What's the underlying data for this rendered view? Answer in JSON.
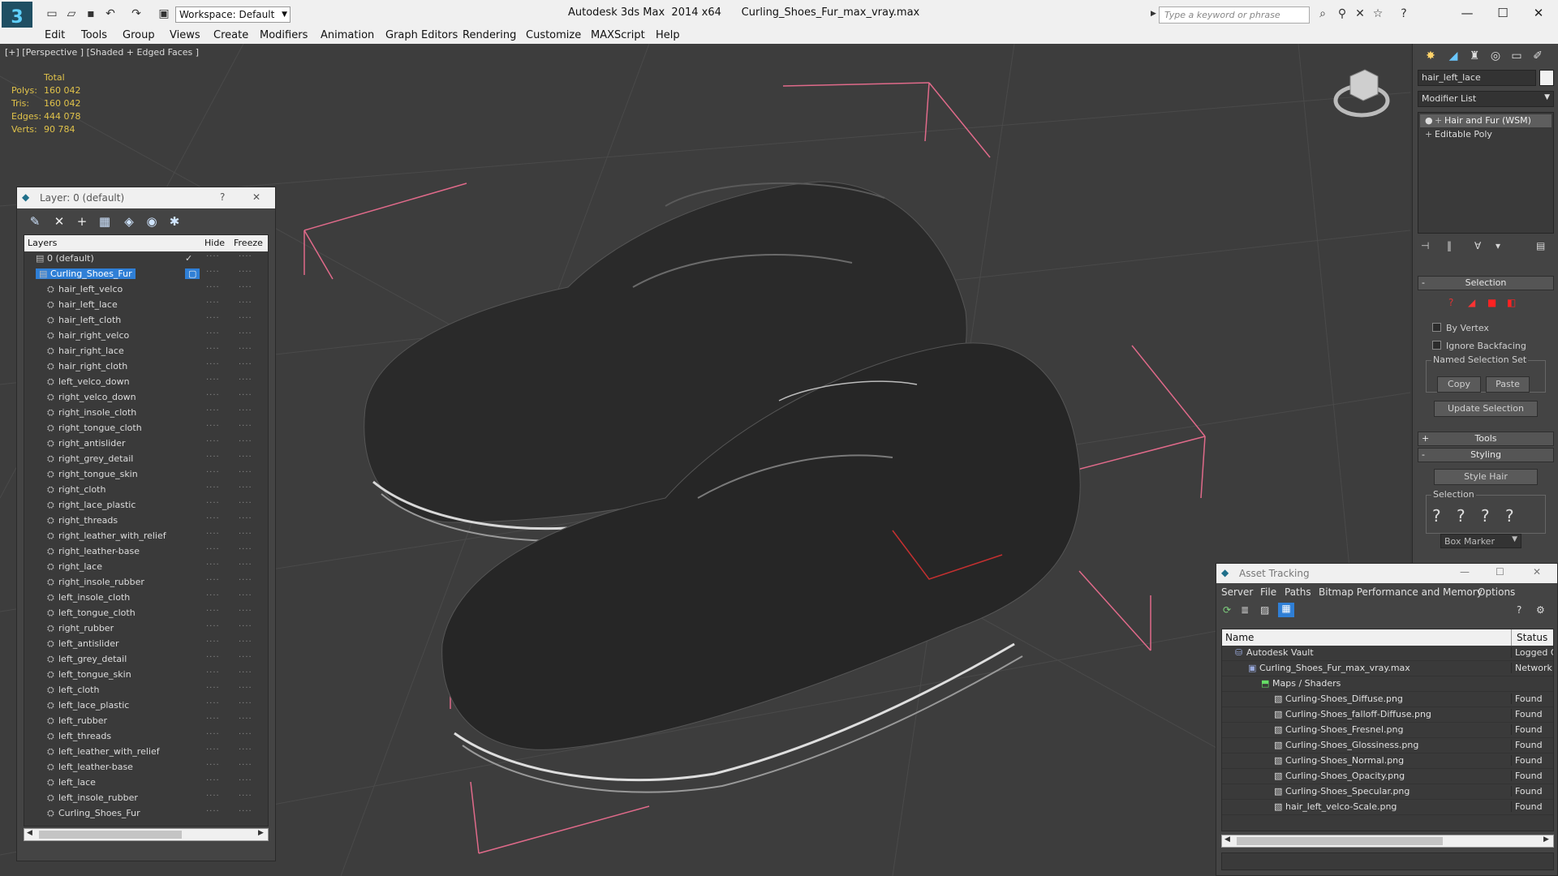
{
  "window": {
    "title": "Autodesk 3ds Max  2014 x64      Curling_Shoes_Fur_max_vray.max",
    "workspace": "Workspace: Default",
    "search_placeholder": "Type a keyword or phrase"
  },
  "menu": [
    "Edit",
    "Tools",
    "Group",
    "Views",
    "Create",
    "Modifiers",
    "Animation",
    "Graph Editors",
    "Rendering",
    "Customize",
    "MAXScript",
    "Help"
  ],
  "viewport": {
    "label": "[+] [Perspective ] [Shaded + Edged Faces ]",
    "stats": {
      "total_label": "Total",
      "rows": [
        {
          "label": "Polys:",
          "value": "160 042"
        },
        {
          "label": "Tris:",
          "value": "160 042"
        },
        {
          "label": "Edges:",
          "value": "444 078"
        },
        {
          "label": "Verts:",
          "value": "90 784"
        }
      ]
    }
  },
  "layer_explorer": {
    "title": "Layer: 0 (default)",
    "help": "?",
    "close": "✕",
    "headers": {
      "layers": "Layers",
      "hide": "Hide",
      "freeze": "Freeze"
    },
    "rows": [
      {
        "name": "0 (default)",
        "level": 1
      },
      {
        "name": "Curling_Shoes_Fur",
        "level": 1
      },
      {
        "name": "hair_left_velco",
        "level": 2
      },
      {
        "name": "hair_left_lace",
        "level": 2
      },
      {
        "name": "hair_left_cloth",
        "level": 2
      },
      {
        "name": "hair_right_velco",
        "level": 2
      },
      {
        "name": "hair_right_lace",
        "level": 2
      },
      {
        "name": "hair_right_cloth",
        "level": 2
      },
      {
        "name": "left_velco_down",
        "level": 2
      },
      {
        "name": "right_velco_down",
        "level": 2
      },
      {
        "name": "right_insole_cloth",
        "level": 2
      },
      {
        "name": "right_tongue_cloth",
        "level": 2
      },
      {
        "name": "right_antislider",
        "level": 2
      },
      {
        "name": "right_grey_detail",
        "level": 2
      },
      {
        "name": "right_tongue_skin",
        "level": 2
      },
      {
        "name": "right_cloth",
        "level": 2
      },
      {
        "name": "right_lace_plastic",
        "level": 2
      },
      {
        "name": "right_threads",
        "level": 2
      },
      {
        "name": "right_leather_with_relief",
        "level": 2
      },
      {
        "name": "right_leather-base",
        "level": 2
      },
      {
        "name": "right_lace",
        "level": 2
      },
      {
        "name": "right_insole_rubber",
        "level": 2
      },
      {
        "name": "left_insole_cloth",
        "level": 2
      },
      {
        "name": "left_tongue_cloth",
        "level": 2
      },
      {
        "name": "right_rubber",
        "level": 2
      },
      {
        "name": "left_antislider",
        "level": 2
      },
      {
        "name": "left_grey_detail",
        "level": 2
      },
      {
        "name": "left_tongue_skin",
        "level": 2
      },
      {
        "name": "left_cloth",
        "level": 2
      },
      {
        "name": "left_lace_plastic",
        "level": 2
      },
      {
        "name": "left_rubber",
        "level": 2
      },
      {
        "name": "left_threads",
        "level": 2
      },
      {
        "name": "left_leather_with_relief",
        "level": 2
      },
      {
        "name": "left_leather-base",
        "level": 2
      },
      {
        "name": "left_lace",
        "level": 2
      },
      {
        "name": "left_insole_rubber",
        "level": 2
      },
      {
        "name": "Curling_Shoes_Fur",
        "level": 2
      }
    ],
    "selected_row": 1,
    "hidden_mark": "····"
  },
  "command_panel": {
    "object_name": "hair_left_lace",
    "modifier_list": "Modifier List",
    "stack": [
      "Hair and Fur (WSM)",
      "Editable Poly"
    ],
    "selection_rollout": "Selection",
    "by_vertex": "By Vertex",
    "ignore_backfacing": "Ignore Backfacing",
    "named_selection_set": "Named Selection Set",
    "copy": "Copy",
    "paste": "Paste",
    "update_selection": "Update Selection",
    "tools_rollout": "Tools",
    "styling_rollout": "Styling",
    "style_hair": "Style Hair",
    "selection_group": "Selection",
    "box_marker": "Box Marker"
  },
  "asset_tracking": {
    "title": "Asset Tracking",
    "menu": [
      "Server",
      "File",
      "Paths",
      "Bitmap Performance and Memory",
      "Options"
    ],
    "headers": {
      "name": "Name",
      "status": "Status"
    },
    "rows": [
      {
        "name": "Autodesk Vault",
        "status": "Logged O",
        "level": 1
      },
      {
        "name": "Curling_Shoes_Fur_max_vray.max",
        "status": "Network F",
        "level": 2
      },
      {
        "name": "Maps / Shaders",
        "status": "",
        "level": 3
      },
      {
        "name": "Curling-Shoes_Diffuse.png",
        "status": "Found",
        "level": 4
      },
      {
        "name": "Curling-Shoes_falloff-Diffuse.png",
        "status": "Found",
        "level": 4
      },
      {
        "name": "Curling-Shoes_Fresnel.png",
        "status": "Found",
        "level": 4
      },
      {
        "name": "Curling-Shoes_Glossiness.png",
        "status": "Found",
        "level": 4
      },
      {
        "name": "Curling-Shoes_Normal.png",
        "status": "Found",
        "level": 4
      },
      {
        "name": "Curling-Shoes_Opacity.png",
        "status": "Found",
        "level": 4
      },
      {
        "name": "Curling-Shoes_Specular.png",
        "status": "Found",
        "level": 4
      },
      {
        "name": "hair_left_velco-Scale.png",
        "status": "Found",
        "level": 4
      }
    ]
  },
  "colors": {
    "accent_selection": "#2f7fd6",
    "stats_text": "#e0c24a",
    "bounding_box": "#e06a8a"
  }
}
